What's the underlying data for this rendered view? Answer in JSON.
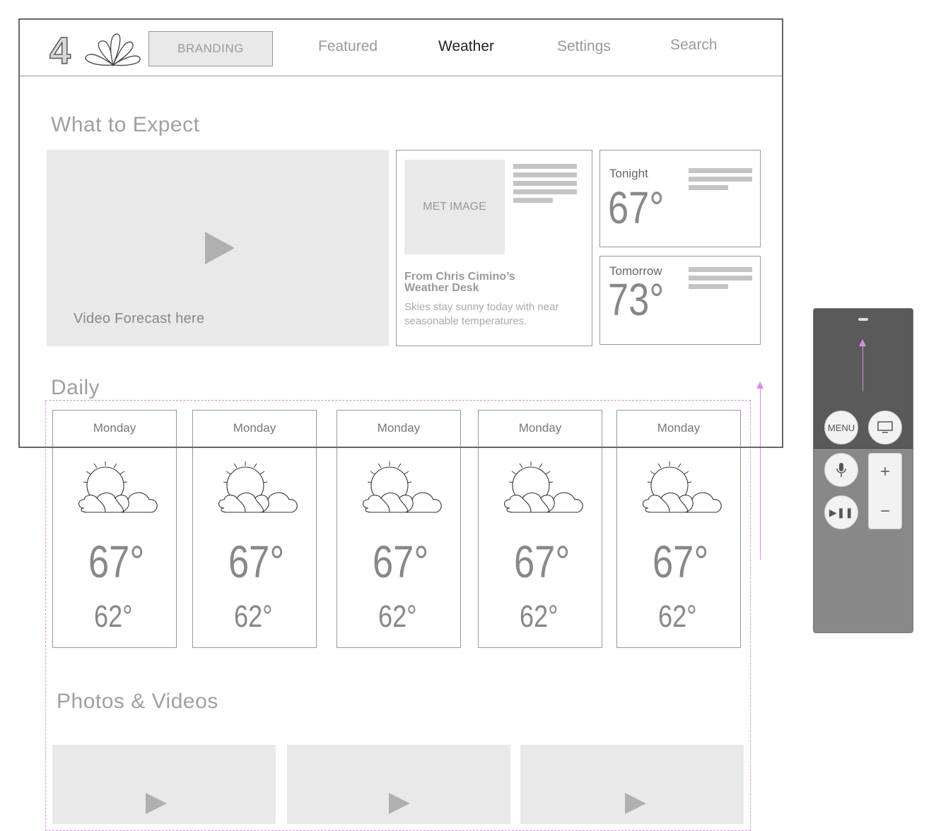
{
  "header": {
    "logo_text": "4",
    "branding": "BRANDING",
    "nav": [
      "Featured",
      "Weather",
      "Settings",
      "Search"
    ],
    "active_nav": "Weather"
  },
  "what_to_expect": {
    "title": "What to Expect",
    "video_label": "Video Forecast here",
    "met_card": {
      "image_label": "MET IMAGE",
      "title": "From Chris Cimino’s Weather Desk",
      "description": "Skies stay sunny today with near seasonable temperatures."
    },
    "tonight": {
      "label": "Tonight",
      "temp": "67°"
    },
    "tomorrow": {
      "label": "Tomorrow",
      "temp": "73°"
    }
  },
  "daily": {
    "title": "Daily",
    "days": [
      {
        "name": "Monday",
        "high": "67°",
        "low": "62°"
      },
      {
        "name": "Monday",
        "high": "67°",
        "low": "62°"
      },
      {
        "name": "Monday",
        "high": "67°",
        "low": "62°"
      },
      {
        "name": "Monday",
        "high": "67°",
        "low": "62°"
      },
      {
        "name": "Monday",
        "high": "67°",
        "low": "62°"
      }
    ]
  },
  "photos_videos": {
    "title": "Photos & Videos"
  },
  "remote": {
    "menu_label": "MENU",
    "plus": "+",
    "minus": "−",
    "play_pause": "▶❚❚"
  },
  "colors": {
    "guide": "#d98ce6",
    "placeholder": "#e9e9e9",
    "active_nav": "#222222"
  }
}
